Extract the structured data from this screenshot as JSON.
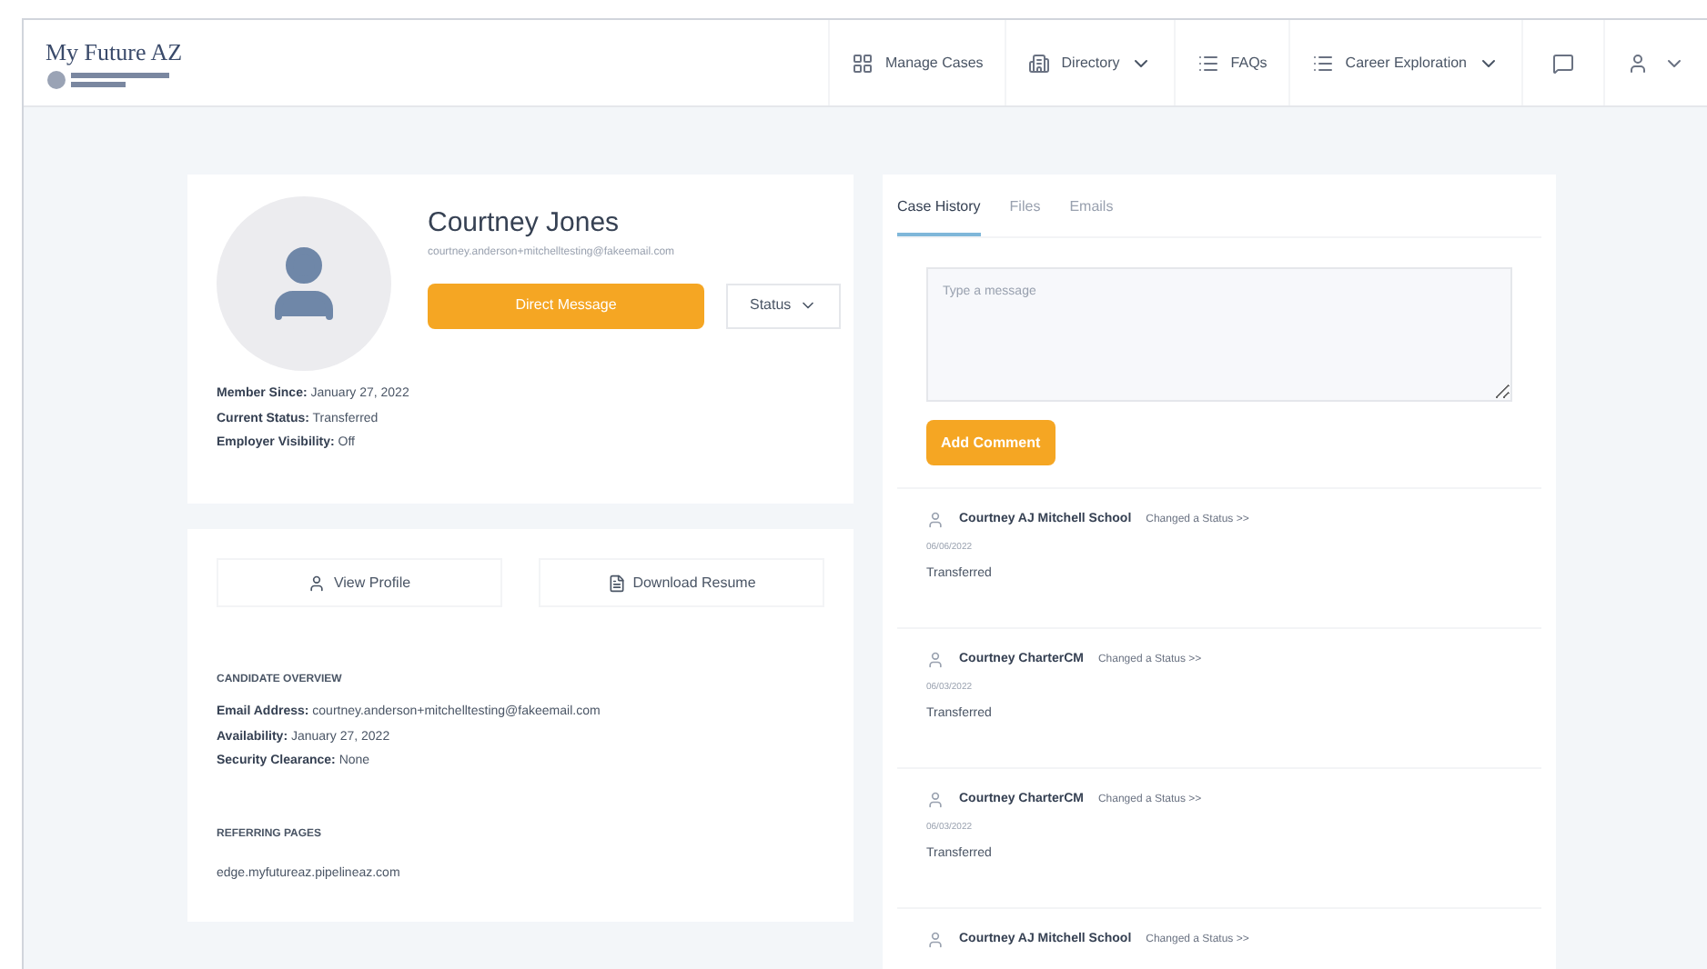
{
  "brand": {
    "title": "My Future AZ"
  },
  "nav": [
    {
      "label": "Manage Cases",
      "dropdown": false
    },
    {
      "label": "Directory",
      "dropdown": true
    },
    {
      "label": "FAQs",
      "dropdown": false
    },
    {
      "label": "Career Exploration",
      "dropdown": true
    }
  ],
  "profile": {
    "name": "Courtney Jones",
    "email": "courtney.anderson+mitchelltesting@fakeemail.com",
    "message_button": "Direct Message",
    "status_button": "Status",
    "facts": [
      {
        "label": "Member Since:",
        "value": "January 27, 2022"
      },
      {
        "label": "Current Status:",
        "value": "Transferred"
      },
      {
        "label": "Employer Visibility:",
        "value": "Off"
      }
    ]
  },
  "actions": [
    "View Profile",
    "Download Resume"
  ],
  "overview": {
    "heading": "CANDIDATE OVERVIEW",
    "facts": [
      {
        "label": "Email Address:",
        "value": "courtney.anderson+mitchelltesting@fakeemail.com"
      },
      {
        "label": "Availability:",
        "value": "January 27, 2022"
      },
      {
        "label": "Security Clearance:",
        "value": "None"
      }
    ]
  },
  "referring": {
    "heading": "REFERRING PAGES",
    "url": "edge.myfutureaz.pipelineaz.com"
  },
  "tabs": [
    {
      "label": "Case History",
      "selected": true
    },
    {
      "label": "Files",
      "selected": false
    },
    {
      "label": "Emails",
      "selected": false
    }
  ],
  "comment": {
    "placeholder": "Type a message",
    "button": "Add Comment"
  },
  "history": [
    {
      "author": "Courtney AJ Mitchell School",
      "action": "Changed a Status >>",
      "date": "06/06/2022",
      "status": "Transferred"
    },
    {
      "author": "Courtney CharterCM",
      "action": "Changed a Status >>",
      "date": "06/03/2022",
      "status": "Transferred"
    },
    {
      "author": "Courtney CharterCM",
      "action": "Changed a Status >>",
      "date": "06/03/2022",
      "status": "Transferred"
    },
    {
      "author": "Courtney AJ Mitchell School",
      "action": "Changed a Status >>"
    }
  ]
}
